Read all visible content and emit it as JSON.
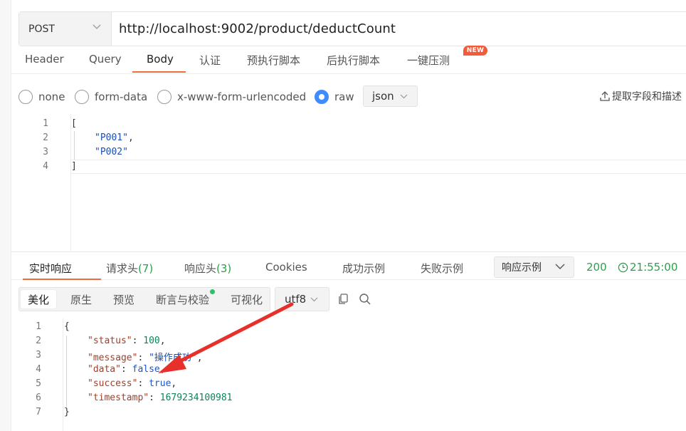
{
  "request": {
    "method": "POST",
    "url": "http://localhost:9002/product/deductCount"
  },
  "request_tabs": [
    {
      "label": "Header"
    },
    {
      "label": "Query"
    },
    {
      "label": "Body"
    },
    {
      "label": "认证"
    },
    {
      "label": "预执行脚本"
    },
    {
      "label": "后执行脚本"
    },
    {
      "label": "一键压测"
    }
  ],
  "new_badge": "NEW",
  "body_types": [
    {
      "label": "none"
    },
    {
      "label": "form-data"
    },
    {
      "label": "x-www-form-urlencoded"
    },
    {
      "label": "raw"
    }
  ],
  "body_format": "json",
  "extract_label": "提取字段和描述",
  "request_body": {
    "line_numbers": [
      "1",
      "2",
      "3",
      "4"
    ],
    "lines": [
      "[",
      "\"P001\"",
      ",",
      "\"P002\"",
      "]"
    ]
  },
  "response_tabs": {
    "realtime": "实时响应",
    "req_headers": "请求头",
    "req_headers_count": "(7)",
    "resp_headers": "响应头",
    "resp_headers_count": "(3)",
    "cookies": "Cookies",
    "success_example": "成功示例",
    "fail_example": "失败示例"
  },
  "example_select": "响应示例",
  "status": {
    "code": "200",
    "time": "21:55:00"
  },
  "view_modes": {
    "beautify": "美化",
    "raw": "原生",
    "preview": "预览",
    "assert": "断言与校验",
    "visualize": "可视化"
  },
  "encoding": "utf8",
  "response_body": {
    "line_numbers": [
      "1",
      "2",
      "3",
      "4",
      "5",
      "6",
      "7"
    ],
    "open_brace": "{",
    "close_brace": "}",
    "fields": [
      {
        "key": "\"status\"",
        "value": "100"
      },
      {
        "key": "\"message\"",
        "value": "\"操作成功\""
      },
      {
        "key": "\"data\"",
        "value": "false"
      },
      {
        "key": "\"success\"",
        "value": "true"
      },
      {
        "key": "\"timestamp\"",
        "value": "1679234100981"
      }
    ]
  },
  "colors": {
    "accent": "#f26b3a",
    "radio_selected": "#3f8cff",
    "success_green": "#2aa14a",
    "annotation_arrow": "#e8302a"
  },
  "icons": [
    "chevron-down-icon",
    "upload-icon",
    "clock-icon",
    "copy-icon",
    "search-icon",
    "annotation-arrow"
  ]
}
